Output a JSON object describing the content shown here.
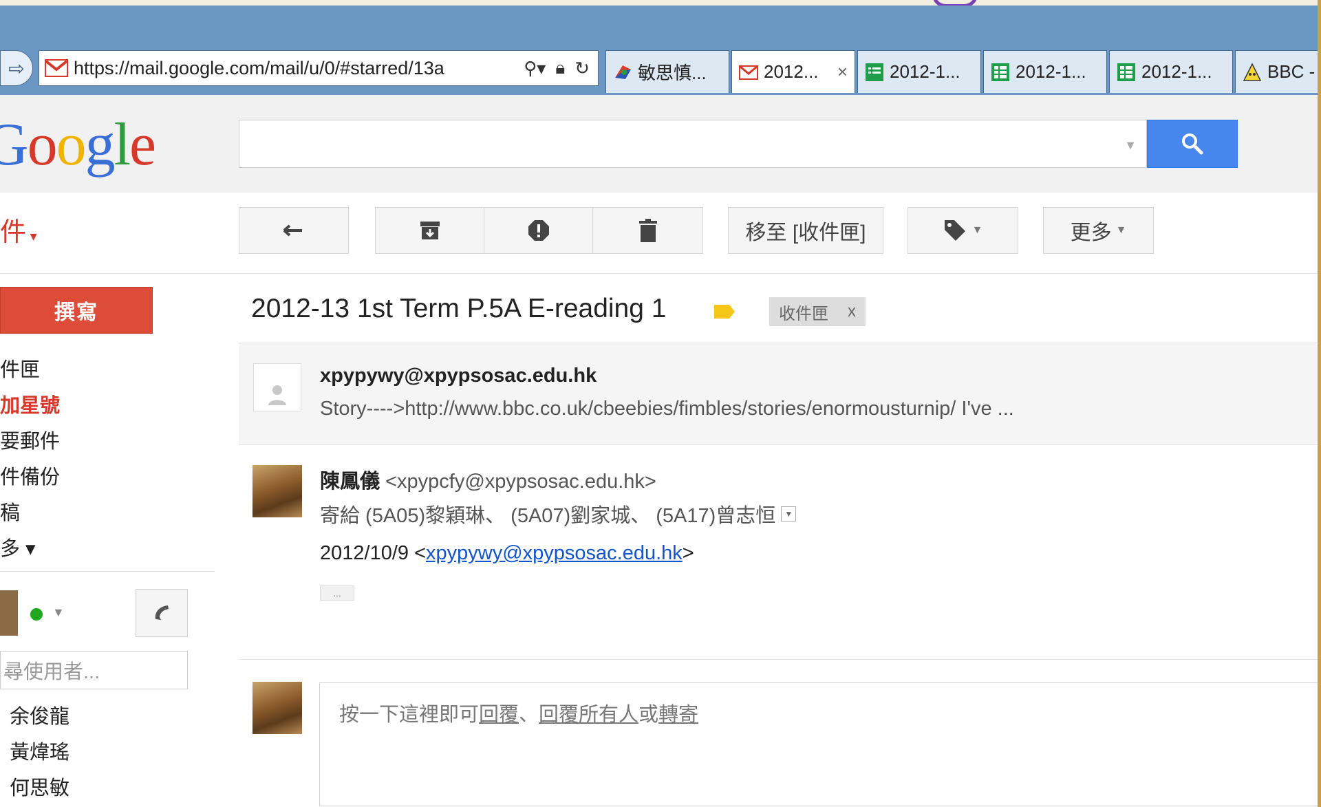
{
  "browser": {
    "url": "https://mail.google.com/mail/u/0/#starred/13a",
    "tabs": [
      {
        "label": "敏思慎...",
        "icon": "colorful-logo-icon",
        "active": false
      },
      {
        "label": "2012...",
        "icon": "gmail-icon",
        "active": true,
        "close": "×"
      },
      {
        "label": "2012-1...",
        "icon": "form-icon",
        "active": false
      },
      {
        "label": "2012-1...",
        "icon": "spreadsheet-icon",
        "active": false
      },
      {
        "label": "2012-1...",
        "icon": "spreadsheet-icon",
        "active": false
      },
      {
        "label": "BBC -",
        "icon": "bbc-character-icon",
        "active": false
      }
    ]
  },
  "header": {
    "logo": {
      "G": "G",
      "o1": "o",
      "o2": "o",
      "g": "g",
      "l": "l",
      "e": "e"
    },
    "mail_label": "件"
  },
  "toolbar": {
    "move_to": "移至 [收件匣]",
    "more": "更多"
  },
  "sidebar": {
    "compose": "撰寫",
    "items": [
      {
        "label": "件匣",
        "active": false
      },
      {
        "label": "加星號",
        "active": true
      },
      {
        "label": "要郵件",
        "active": false
      },
      {
        "label": "件備份",
        "active": false
      },
      {
        "label": "稿",
        "active": false
      },
      {
        "label": "多 ▾",
        "active": false
      }
    ],
    "people_search_placeholder": "尋使用者...",
    "contacts": [
      "余俊龍",
      "黃煒瑤",
      "何思敏"
    ]
  },
  "thread": {
    "subject": "2012-13 1st Term P.5A E-reading 1",
    "label_chip": "收件匣",
    "label_chip_close": "x",
    "messages": [
      {
        "sender": "xpypywy@xpypsosac.edu.hk",
        "snippet": "Story---->http://www.bbc.co.uk/cbeebies/fimbles/stories/enormousturnip/ I've ..."
      },
      {
        "sender_name": "陳鳳儀",
        "sender_email": "<xpypcfy@xpypsosac.edu.hk>",
        "to_line": "寄給 (5A05)黎穎琳、 (5A07)劉家城、 (5A17)曾志恒",
        "date": "2012/10/9 <",
        "quoted_email": "xpypywy@xpypsosac.edu.hk",
        "date_suffix": ">",
        "ellipsis": "..."
      }
    ],
    "reply_prompt": {
      "pre": "按一下這裡即可",
      "reply": "回覆",
      "sep": "、",
      "reply_all": "回覆所有人",
      "or": "或",
      "forward": "轉寄"
    }
  },
  "colors": {
    "chrome_blue": "#6a97c4",
    "compose_red": "#dd4b39",
    "search_blue": "#4787ed",
    "slide_gold": "#c8a24a"
  }
}
